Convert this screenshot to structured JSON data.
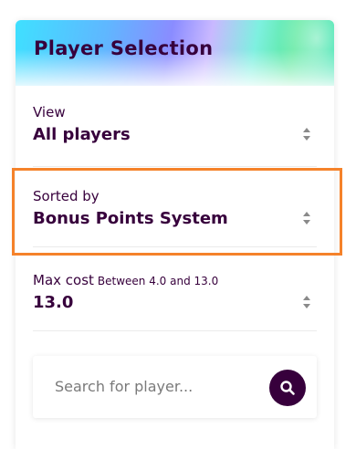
{
  "panel": {
    "title": "Player Selection"
  },
  "filters": {
    "view": {
      "label": "View",
      "value": "All players"
    },
    "sorted_by": {
      "label": "Sorted by",
      "value": "Bonus Points System"
    },
    "max_cost": {
      "label": "Max cost",
      "hint": "Between 4.0 and 13.0",
      "value": "13.0"
    }
  },
  "search": {
    "placeholder": "Search for player...",
    "button_icon": "search-icon"
  },
  "colors": {
    "brand_purple": "#37003c",
    "highlight_orange": "#f5822a"
  }
}
